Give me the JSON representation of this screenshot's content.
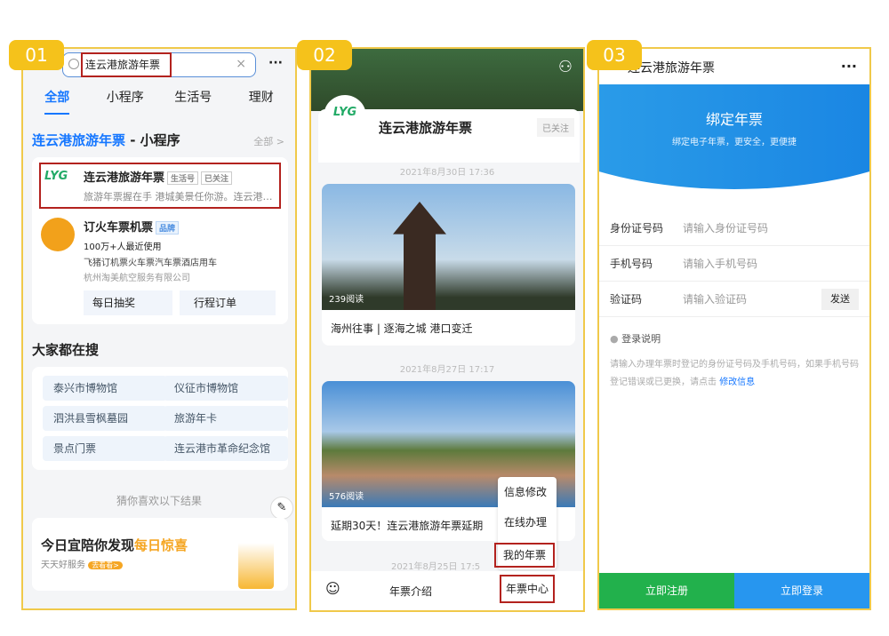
{
  "badges": [
    "01",
    "02",
    "03"
  ],
  "p1": {
    "search_value": "连云港旅游年票",
    "more": "···",
    "tabs": [
      "全部",
      "小程序",
      "生活号",
      "理财"
    ],
    "section_title_highlight": "连云港旅游年票",
    "section_title_rest": " - 小程序",
    "section_all": "全部 >",
    "result1": {
      "name": "连云港旅游年票",
      "tags": [
        "生活号",
        "已关注"
      ],
      "desc": "旅游年票握在手 港城美景任你游。连云港…"
    },
    "result2": {
      "name": "订火车票机票",
      "tag": "品牌",
      "users": "100万+人最近使用",
      "desc": "飞猪订机票火车票汽车票酒店用车",
      "company": "杭州淘美航空服务有限公司",
      "actions": [
        "每日抽奖",
        "行程订单"
      ]
    },
    "hot_title": "大家都在搜",
    "hot": [
      "泰兴市博物馆",
      "仪征市博物馆",
      "泗洪县雪枫墓园",
      "旅游年卡",
      "景点门票",
      "连云港市革命纪念馆"
    ],
    "guess": "猜你喜欢以下结果",
    "promo": {
      "title": "今日宜陪你发现",
      "highlight": "每日惊喜",
      "sub": "天天好服务",
      "btn": "去看看>"
    }
  },
  "p2": {
    "name": "连云港旅游年票",
    "follow": "已关注",
    "posts": [
      {
        "date": "2021年8月30日 17:36",
        "reads": "239阅读",
        "title": "海州往事 | 逐海之城 港口变迁"
      },
      {
        "date": "2021年8月27日 17:17",
        "reads": "576阅读",
        "title": "延期30天！连云港旅游年票延期"
      }
    ],
    "date3": "2021年8月25日 17:5",
    "menu": [
      "信息修改",
      "在线办理",
      "我的年票"
    ],
    "nav": [
      "年票介绍",
      "年票中心"
    ]
  },
  "p3": {
    "title": "连云港旅游年票",
    "more": "···",
    "banner_title": "绑定年票",
    "banner_sub": "绑定电子年票，更安全，更便捷",
    "fields": [
      {
        "label": "身份证号码",
        "placeholder": "请输入身份证号码"
      },
      {
        "label": "手机号码",
        "placeholder": "请输入手机号码"
      },
      {
        "label": "验证码",
        "placeholder": "请输入验证码"
      }
    ],
    "send": "发送",
    "note_title": "登录说明",
    "note": "请输入办理年票时登记的身份证号码及手机号码，如果手机号码登记错误或已更换，请点击",
    "note_link": "修改信息",
    "register": "立即注册",
    "login": "立即登录"
  }
}
